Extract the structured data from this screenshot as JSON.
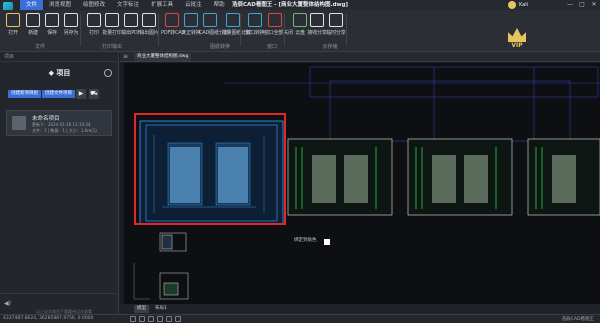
{
  "app": {
    "menu_tabs": [
      "文件",
      "浏览视图",
      "绘图修改",
      "文字标注",
      "扩展工具",
      "云批注",
      "帮助"
    ],
    "active_tab": 0,
    "window_title": "浩辰CAD看图王 - [商业大厦整体结构图.dwg]",
    "username": "Kali"
  },
  "ribbon": {
    "buttons": [
      {
        "label": "打开",
        "icon": "open-folder-icon",
        "color": "#e6c460"
      },
      {
        "label": "新建",
        "icon": "new-file-icon",
        "color": "#dfe3e8"
      },
      {
        "label": "保存",
        "icon": "save-icon",
        "color": "#dfe3e8"
      },
      {
        "label": "另存为",
        "icon": "save-as-icon",
        "color": "#dfe3e8"
      },
      {
        "label": "打印",
        "icon": "print-icon",
        "color": "#dfe3e8"
      },
      {
        "label": "批量打印",
        "icon": "batch-print-icon",
        "color": "#dfe3e8"
      },
      {
        "label": "输出PDF",
        "icon": "export-pdf-icon",
        "color": "#dfe3e8"
      },
      {
        "label": "输出图片",
        "icon": "export-image-icon",
        "color": "#dfe3e8"
      },
      {
        "label": "PDF转CAD",
        "icon": "pdf-to-cad-icon",
        "color": "#d94a3d"
      },
      {
        "label": "天正转换",
        "icon": "tianzheng-convert-icon",
        "color": "#3fa7d6"
      },
      {
        "label": "CAD图纸分割",
        "icon": "cad-split-icon",
        "color": "#3fa7d6"
      },
      {
        "label": "批量图纸比较",
        "icon": "batch-compare-icon",
        "color": "#3fa7d6"
      },
      {
        "label": "窗口转换",
        "icon": "window-switch-icon",
        "color": "#3fa7d6"
      },
      {
        "label": "窗口全部关闭",
        "icon": "close-all-windows-icon",
        "color": "#d94a3d"
      },
      {
        "label": "云盘",
        "icon": "cloud-drive-icon",
        "color": "#5fc35f"
      },
      {
        "label": "接收分享",
        "icon": "receive-share-icon",
        "color": "#dfe3e8"
      },
      {
        "label": "临时分享",
        "icon": "temp-share-icon",
        "color": "#dfe3e8"
      }
    ],
    "groups": [
      "文件",
      "打印输出",
      "图纸转换",
      "窗口",
      "云存储"
    ],
    "vip_label": "VIP"
  },
  "left_panel": {
    "header": "项目",
    "title": "项目",
    "new_project_button": "创建新项目组",
    "create_file_button": "创建文件项目",
    "project": {
      "name": "未命名项目",
      "created": "更新于：2024-01-16 11:10:34",
      "stats": "文件：1 | 数量：1 | 大小：1.6m(1)"
    },
    "footer_hint": "以上仅为浏览下载路径点击查看"
  },
  "document": {
    "tab_label": "商业大厦整体结构图.dwg",
    "model_tabs": [
      "模型",
      "布局1"
    ],
    "drawing_label": "绑定到角色"
  },
  "status": {
    "coords": "43374B7.8624, 36285887.9756, 0.0000",
    "brand": "浩辰CAD看图王"
  }
}
